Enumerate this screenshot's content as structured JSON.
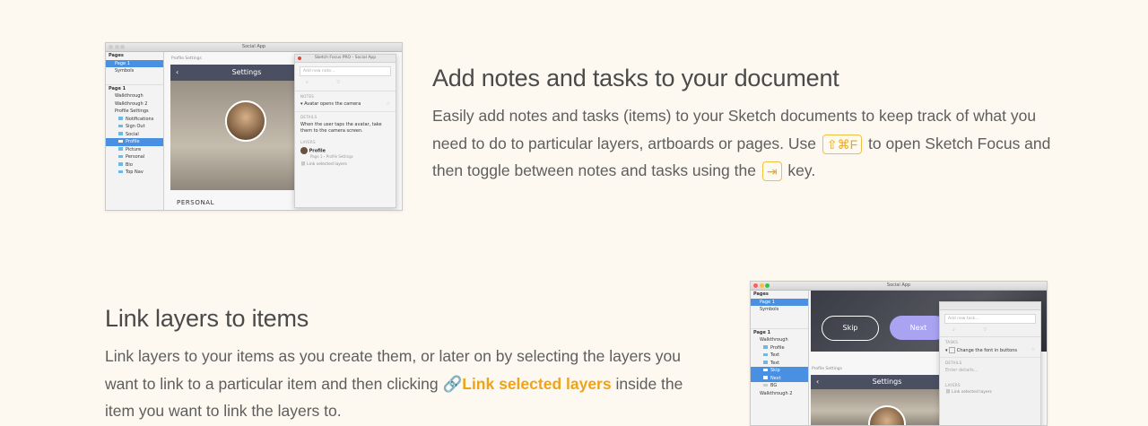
{
  "section1": {
    "title": "Add notes and tasks to your document",
    "para_part1": "Easily add notes and tasks (items) to your Sketch documents to keep track of what you need to do to particular layers, artboards or pages. Use ",
    "shortcut_key": "⇧⌘F",
    "para_part2": " to open Sketch Focus and then toggle between notes and tasks using the ",
    "tab_key": "⇥",
    "para_part3": " key.",
    "shot": {
      "window_title": "Social App",
      "sidebar_pages_label": "Pages",
      "pages": [
        "Page 1",
        "Symbols"
      ],
      "layers_label": "Page 1",
      "layers": [
        "Walkthrough",
        "Walkthrough 2",
        "Profile Settings",
        "Notifications",
        "Sign Out",
        "Social",
        "Profile",
        "Picture",
        "Personal",
        "Bio",
        "Top Nav"
      ],
      "artboard_label": "Profile Settings",
      "nav_title": "Settings",
      "personal_label": "PERSONAL",
      "panel_title": "Sketch Focus PRO - Social App",
      "panel_input_placeholder": "Add new note...",
      "notes_label": "NOTES",
      "note_item": "Avatar opens the camera",
      "details_label": "DETAILS",
      "details_text": "When the user taps the avatar, take them to the camera screen.",
      "layers_section_label": "LAYERS",
      "layer_link_name": "Profile",
      "layer_link_path": "Page 1  ›  Profile Settings",
      "link_selected": "Link selected layers"
    }
  },
  "section2": {
    "title": "Link layers to items",
    "para_part1": "Link layers to your items as you create them, or later on by selecting the layers you want to link to a particular item and then clicking ",
    "link_label": "Link selected layers",
    "para_part2": " inside the item you want to link the layers to.",
    "shot": {
      "window_title": "Social App",
      "sidebar_pages_label": "Pages",
      "pages": [
        "Page 1",
        "Symbols"
      ],
      "layers_label": "Page 1",
      "layers": [
        "Walkthrough",
        "Profile",
        "Text",
        "Text",
        "Skip",
        "Next",
        "BG",
        "Walkthrough 2"
      ],
      "skip_label": "Skip",
      "next_label": "Next",
      "artboard_label": "Profile Settings",
      "nav_title": "Settings",
      "panel_input_placeholder": "Add new task...",
      "tasks_label": "TASKS",
      "task_item": "Change the font in buttons",
      "details_label": "DETAILS",
      "details_placeholder": "Enter details...",
      "layers_section_label": "LAYERS",
      "link_selected": "Link selected layers"
    }
  },
  "colors": {
    "background": "#fdf9f0",
    "accent": "#eea31a",
    "heading": "#4a4a4a",
    "body": "#5e5e5e"
  }
}
